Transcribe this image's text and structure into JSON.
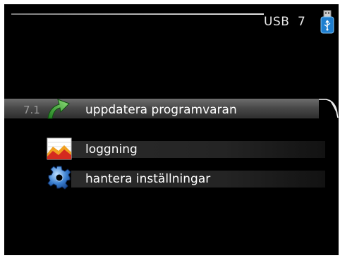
{
  "header": {
    "title": "USB",
    "menu_number": "7",
    "icon": "usb-stick-icon"
  },
  "menu": {
    "items": [
      {
        "id": "7.1",
        "label": "uppdatera programvaran",
        "icon": "update-arrow-icon",
        "selected": true
      },
      {
        "id": "",
        "label": "loggning",
        "icon": "log-chart-icon",
        "selected": false
      },
      {
        "id": "",
        "label": "hantera inställningar",
        "icon": "gear-icon",
        "selected": false
      }
    ]
  },
  "colors": {
    "background": "#000000",
    "text": "#ffffff",
    "selection_bar": "#4a4a4a",
    "usb_icon_blue": "#1f7fd0",
    "update_icon_green": "#3fa63a",
    "log_icon_red": "#d42a1f",
    "gear_icon_blue": "#2f6fc0"
  }
}
